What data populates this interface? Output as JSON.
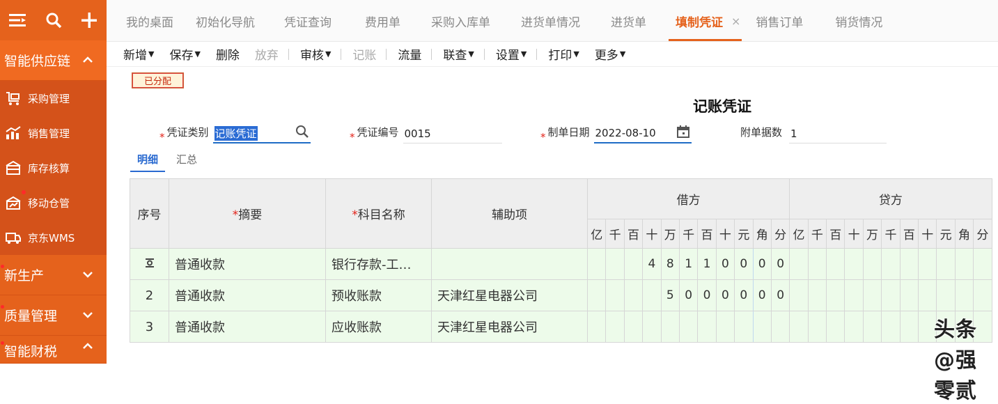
{
  "sidebar": {
    "sections": [
      {
        "label": "智能供应链",
        "expanded": true
      },
      {
        "label": "新生产",
        "expanded": false
      },
      {
        "label": "质量管理",
        "expanded": false
      },
      {
        "label": "智能财税",
        "expanded": true
      }
    ],
    "items": [
      {
        "label": "采购管理",
        "icon": "purchase-cart-icon"
      },
      {
        "label": "销售管理",
        "icon": "sales-chart-icon"
      },
      {
        "label": "库存核算",
        "icon": "inventory-icon"
      },
      {
        "label": "移动仓管",
        "icon": "mobile-warehouse-icon"
      },
      {
        "label": "京东WMS",
        "icon": "truck-icon"
      }
    ]
  },
  "tabs": [
    {
      "label": "我的桌面"
    },
    {
      "label": "初始化导航"
    },
    {
      "label": "凭证查询"
    },
    {
      "label": "费用单"
    },
    {
      "label": "采购入库单"
    },
    {
      "label": "进货单情况"
    },
    {
      "label": "进货单"
    },
    {
      "label": "填制凭证",
      "active": true,
      "close": "×"
    },
    {
      "label": "销售订单"
    },
    {
      "label": "销货情况"
    }
  ],
  "toolbar": {
    "add": "新增",
    "save": "保存",
    "delete": "删除",
    "abandon": "放弃",
    "review": "审核",
    "post": "记账",
    "flow": "流量",
    "query": "联查",
    "settings": "设置",
    "print": "打印",
    "more": "更多"
  },
  "status_badge": "已分配",
  "voucher_title": "记账凭证",
  "form": {
    "category_label": "凭证类别",
    "category_value": "记账凭证",
    "number_label": "凭证编号",
    "number_value": "0015",
    "date_label": "制单日期",
    "date_value": "2022-08-10",
    "attach_label": "附单据数",
    "attach_value": "1"
  },
  "subtabs": {
    "detail": "明细",
    "summary": "汇总"
  },
  "grid": {
    "headers": {
      "seq": "序号",
      "summary": "摘要",
      "account": "科目名称",
      "aux": "辅助项",
      "debit": "借方",
      "credit": "贷方"
    },
    "digit_headers": [
      "亿",
      "千",
      "百",
      "十",
      "万",
      "千",
      "百",
      "十",
      "元",
      "角",
      "分"
    ],
    "rows": [
      {
        "seq": "",
        "summary": "普通收款",
        "account": "银行存款-工…",
        "aux": "",
        "debit": [
          "",
          "",
          "",
          "4",
          "8",
          "1",
          "1",
          "0",
          "0",
          "0",
          "0"
        ],
        "credit": [
          "",
          "",
          "",
          "",
          "",
          "",
          "",
          "",
          "",
          "",
          ""
        ]
      },
      {
        "seq": "2",
        "summary": "普通收款",
        "account": "预收账款",
        "aux": "天津红星电器公司",
        "debit": [
          "",
          "",
          "",
          "",
          "5",
          "0",
          "0",
          "0",
          "0",
          "0",
          "0"
        ],
        "credit": [
          "",
          "",
          "",
          "",
          "",
          "",
          "",
          "",
          "",
          "",
          ""
        ]
      },
      {
        "seq": "3",
        "summary": "普通收款",
        "account": "应收账款",
        "aux": "天津红星电器公司",
        "debit": [
          "",
          "",
          "",
          "",
          "",
          "",
          "",
          "",
          "",
          "",
          ""
        ],
        "credit": [
          "",
          "",
          "",
          "",
          "",
          "",
          "",
          "",
          "",
          "",
          ""
        ]
      }
    ]
  },
  "watermark": "头条 @强零贰"
}
